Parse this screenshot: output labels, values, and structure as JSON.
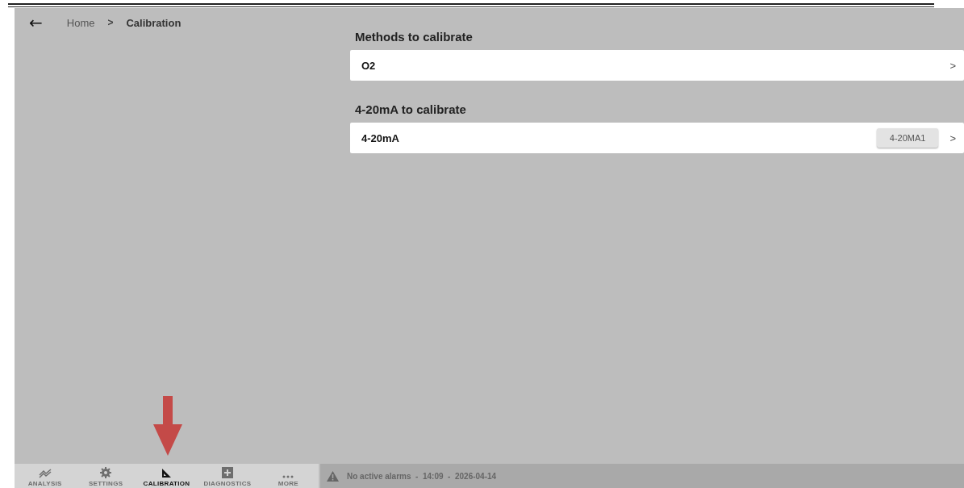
{
  "breadcrumb": {
    "back": "←",
    "items": [
      {
        "label": "Home",
        "current": false
      },
      {
        "label": "Calibration",
        "current": true
      }
    ],
    "separator": ">"
  },
  "sections": [
    {
      "title": "Methods to calibrate",
      "rows": [
        {
          "label": "O2",
          "chevron": ">"
        }
      ]
    },
    {
      "title": "4-20mA to calibrate",
      "rows": [
        {
          "label": "4-20mA",
          "tag": "4-20MA1",
          "chevron": ">"
        }
      ]
    }
  ],
  "nav": [
    {
      "label": "ANALYSIS",
      "kind": "chart",
      "selected": false
    },
    {
      "label": "SETTINGS",
      "kind": "gear",
      "selected": false
    },
    {
      "label": "CALIBRATION",
      "kind": "ruler",
      "selected": true
    },
    {
      "label": "DIAGNOSTICS",
      "kind": "plus",
      "selected": false
    },
    {
      "label": "MORE",
      "kind": "dots",
      "selected": false
    }
  ],
  "status_bar": {
    "alarms": "No active alarms",
    "time": "14:09",
    "date": "2026-04-14",
    "separator": "-"
  }
}
